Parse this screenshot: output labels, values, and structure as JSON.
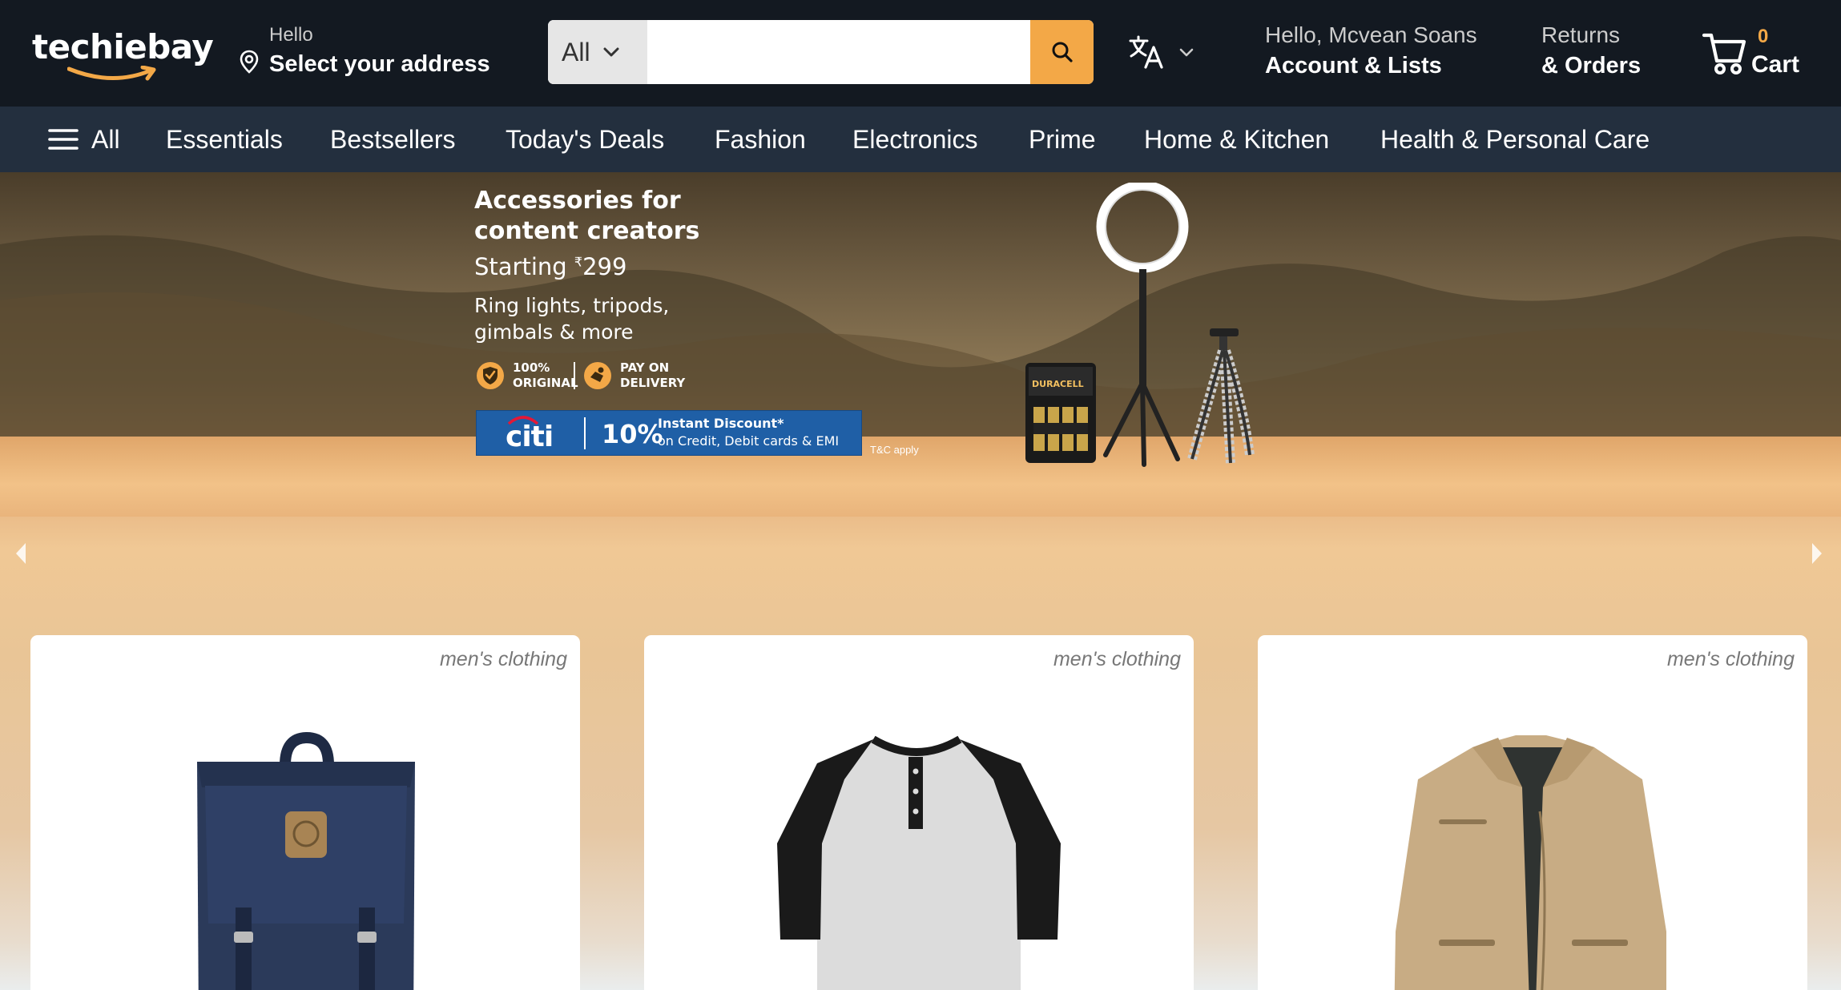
{
  "header": {
    "logo_text": "techiebay",
    "address_greeting": "Hello",
    "address_label": "Select your address",
    "search": {
      "category": "All",
      "placeholder": ""
    },
    "account_greeting": "Hello, Mcvean Soans",
    "account_label": "Account & Lists",
    "returns_line1": "Returns",
    "returns_line2": "& Orders",
    "cart_count": "0",
    "cart_label": "Cart",
    "accent_color": "#f3a847"
  },
  "nav": {
    "all_label": "All",
    "items": [
      "Essentials",
      "Bestsellers",
      "Today's Deals",
      "Fashion",
      "Electronics",
      "Prime",
      "Home & Kitchen",
      "Health & Personal Care"
    ]
  },
  "banner": {
    "title_line1": "Accessories for",
    "title_line2": "content creators",
    "price_prefix": "Starting ",
    "currency": "₹",
    "price": "299",
    "desc_line1": "Ring lights, tripods,",
    "desc_line2": "gimbals & more",
    "badge1_line1": "100%",
    "badge1_line2": "ORIGINAL",
    "badge2_line1": "PAY ON",
    "badge2_line2": "DELIVERY",
    "bank_name": "citi",
    "discount": "10%",
    "discount_line1": "Instant Discount*",
    "discount_line2": "on Credit, Debit cards & EMI",
    "tnc": "T&C apply",
    "battery_brand": "DURACELL"
  },
  "products": [
    {
      "category": "men's clothing",
      "image": "backpack"
    },
    {
      "category": "men's clothing",
      "image": "raglan-henley-shirt"
    },
    {
      "category": "men's clothing",
      "image": "cotton-jacket"
    }
  ]
}
